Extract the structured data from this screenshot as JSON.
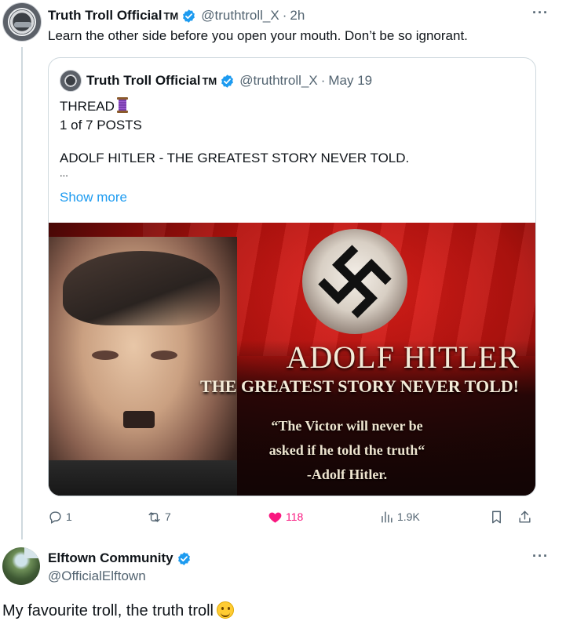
{
  "post": {
    "author_name": "Truth Troll Official",
    "author_tm": "TM",
    "handle": "@truthtroll_X",
    "separator": "·",
    "time": "2h",
    "text": "Learn the other side before you open your mouth. Don’t be so ignorant.",
    "more": "···"
  },
  "quoted": {
    "author_name": "Truth Troll Official",
    "author_tm": "TM",
    "handle": "@truthtroll_X",
    "separator": "·",
    "date": "May 19",
    "line1": "THREAD",
    "line2": "1 of 7 POSTS",
    "line3": "ADOLF HITLER - THE GREATEST STORY NEVER TOLD.",
    "ellipsis": "...",
    "show_more": "Show more",
    "image": {
      "title": "ADOLF HITLER",
      "subtitle": "THE GREATEST STORY NEVER TOLD!",
      "quote_line1": "“The Victor will never be",
      "quote_line2": "asked if he told the truth“",
      "quote_line3": "-Adolf Hitler."
    }
  },
  "actions": {
    "replies": "1",
    "reposts": "7",
    "likes": "118",
    "views": "1.9K",
    "like_color": "#f91880",
    "icon_color": "#536471"
  },
  "reply": {
    "author_name": "Elftown Community",
    "handle": "@OfficialElftown",
    "text": "My favourite troll, the truth troll",
    "more": "···"
  },
  "colors": {
    "link": "#1d9bf0",
    "verified": "#1d9bf0",
    "secondary_text": "#536471"
  }
}
